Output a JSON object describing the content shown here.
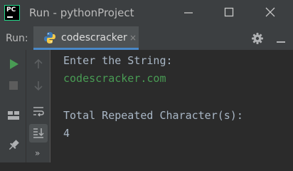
{
  "window": {
    "title": "Run - pythonProject",
    "app_logo": "PC"
  },
  "run_panel": {
    "label": "Run:",
    "tab": {
      "label": "codescracker",
      "close": "×",
      "icon": "python-icon"
    },
    "more_label": "»"
  },
  "console": {
    "lines": [
      "Enter the String:",
      "codescracker.com",
      "Total Repeated Character(s):",
      "4"
    ]
  },
  "colors": {
    "background": "#2b2b2b",
    "chrome": "#3c3f41",
    "text": "#a9b7c6",
    "user_input": "#499c54",
    "run_green": "#499c54",
    "tab_accent": "#4a88c7"
  }
}
